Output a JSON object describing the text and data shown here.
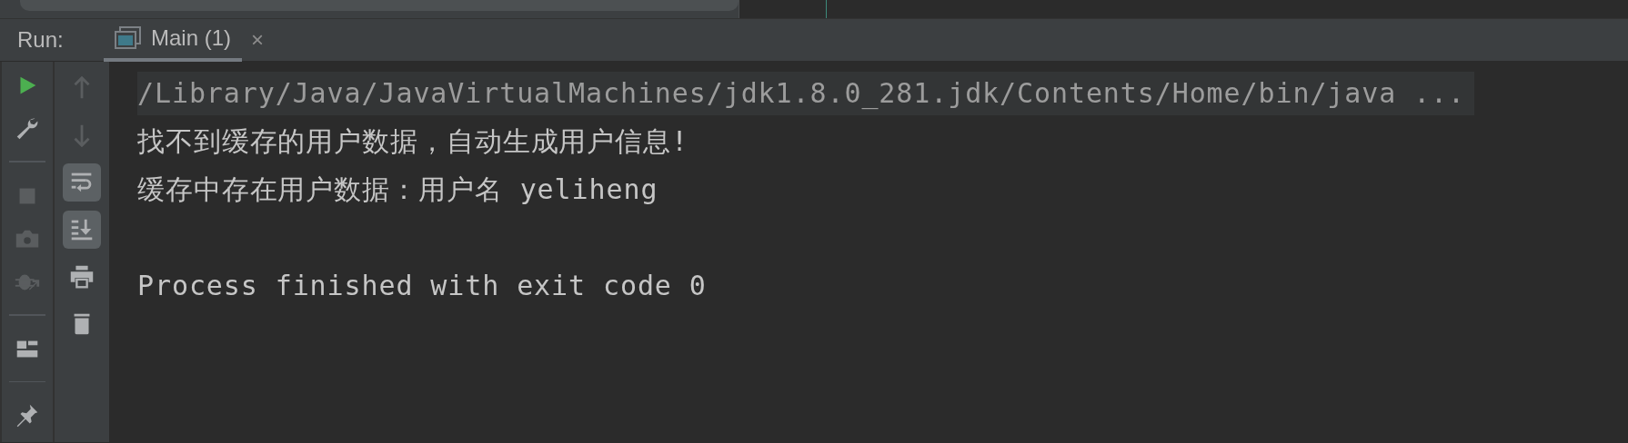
{
  "run_panel": {
    "label": "Run:",
    "tabs": [
      {
        "title": "Main (1)",
        "close": "×",
        "selected": true
      }
    ]
  },
  "left_toolbar": [
    {
      "kind": "run",
      "disabled": false
    },
    {
      "kind": "wrench",
      "disabled": false
    },
    {
      "kind": "separator"
    },
    {
      "kind": "stop",
      "disabled": true
    },
    {
      "kind": "camera",
      "disabled": true
    },
    {
      "kind": "bug",
      "disabled": true
    },
    {
      "kind": "separator"
    },
    {
      "kind": "layout",
      "disabled": false
    },
    {
      "kind": "separator"
    },
    {
      "kind": "pin",
      "disabled": false
    }
  ],
  "console_toolbar": [
    {
      "kind": "up",
      "disabled": true,
      "on": false
    },
    {
      "kind": "down",
      "disabled": true,
      "on": false
    },
    {
      "kind": "wrap",
      "disabled": false,
      "on": true
    },
    {
      "kind": "scroll-end",
      "disabled": false,
      "on": true
    },
    {
      "kind": "print",
      "disabled": false,
      "on": false
    },
    {
      "kind": "trash",
      "disabled": false,
      "on": false
    }
  ],
  "console": [
    {
      "kind": "command",
      "text": "/Library/Java/JavaVirtualMachines/jdk1.8.0_281.jdk/Contents/Home/bin/java ..."
    },
    {
      "kind": "output",
      "text": "找不到缓存的用户数据，自动生成用户信息!"
    },
    {
      "kind": "output",
      "text": "缓存中存在用户数据：用户名 yeliheng"
    },
    {
      "kind": "blank"
    },
    {
      "kind": "output",
      "text": "Process finished with exit code 0"
    }
  ]
}
